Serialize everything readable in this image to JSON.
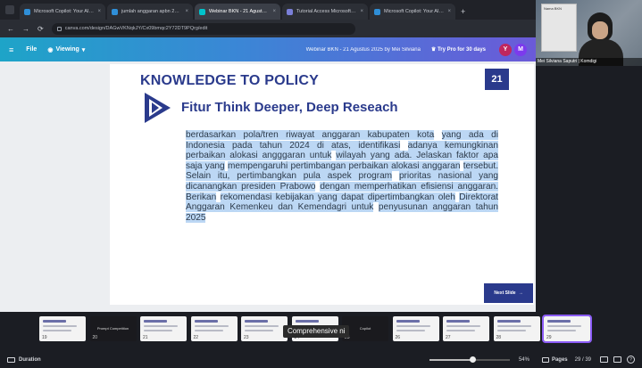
{
  "browser": {
    "tabs": [
      {
        "label": "Microsoft Copilot: Your AI com",
        "color": "#2f8fd8"
      },
      {
        "label": "jumlah anggaran apbn 2024 di",
        "color": "#2f8fd8"
      },
      {
        "label": "Webinar BKN - 21 Agustus 2025",
        "color": "#00c4cc"
      },
      {
        "label": "Tutorial Access Microsoft Copil",
        "color": "#7a7fd8"
      },
      {
        "label": "Microsoft Copilot: Your AI com",
        "color": "#2f8fd8"
      }
    ],
    "new_tab": "+",
    "url": "canva.com/design/DAGwVKNqkJY/Cx09bmqc2Y72DT9PQrg/edit"
  },
  "toolbar": {
    "menu_icon": "≡",
    "file_label": "File",
    "viewing_label": "Viewing",
    "doc_title": "Webinar BKN - 21 Agustus 2025 by Mei Silviana",
    "pro_label": "Try Pro for 30 days",
    "avatars": [
      {
        "letter": "Y",
        "color": "#c0265e"
      },
      {
        "letter": "M",
        "color": "#7c3aed"
      }
    ]
  },
  "webcam": {
    "caption": "Mei Silviana Saputri | Komdigi",
    "poster_text": "Nama BKN"
  },
  "slide": {
    "number": "21",
    "title": "KNOWLEDGE TO POLICY",
    "subtitle": "Fitur Think Deeper, Deep Reseach",
    "prompt_lines": [
      "berdasarkan pola/tren riwayat anggaran kabupaten kota",
      "yang ada di Indonesia pada tahun 2024 di atas, identifikasi",
      "adanya kemungkinan perbaikan alokasi angggaran untuk",
      "wilayah yang ada. Jelaskan faktor apa saja yang",
      "mempengaruhi pertimbangan perbaikan alokasi anggaran",
      "tersebut. Selain itu, pertimbangkan pula aspek program",
      "prioritas nasional yang dicanangkan presiden Prabowo",
      "dengan memperhatikan efisiensi anggaran. Berikan",
      "rekomendasi kebijakan yang dapat dipertimbangkan oleh",
      "Direktorat Anggaran Kemenkeu dan Kemendagri untuk",
      "penyusunan anggaran tahun 2025"
    ],
    "next_label": "Next Slide"
  },
  "thumbnails": [
    {
      "n": "19",
      "dark": false
    },
    {
      "n": "20",
      "dark": true,
      "text": "Prompt Competition"
    },
    {
      "n": "21",
      "dark": false
    },
    {
      "n": "22",
      "dark": false
    },
    {
      "n": "23",
      "dark": false
    },
    {
      "n": "24",
      "dark": false
    },
    {
      "n": "25",
      "dark": true,
      "text": "Copilot"
    },
    {
      "n": "26",
      "dark": false
    },
    {
      "n": "27",
      "dark": false
    },
    {
      "n": "28",
      "dark": false
    },
    {
      "n": "29",
      "dark": false,
      "selected": true
    }
  ],
  "tooltip": "Comprehensive ni",
  "status": {
    "duration_label": "Duration",
    "zoom": "54%",
    "zoom_fraction": 0.54,
    "pages_label": "Pages",
    "page_count": "29 / 39",
    "help": "?"
  }
}
